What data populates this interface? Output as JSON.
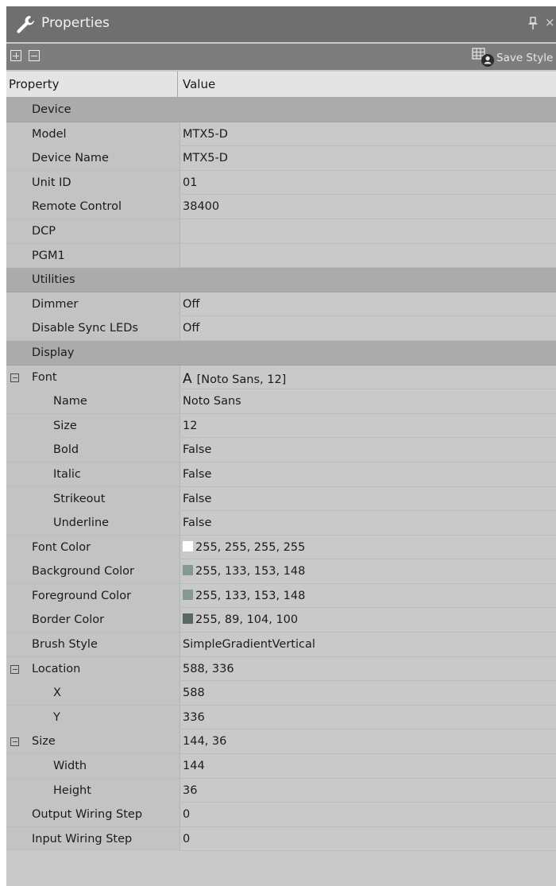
{
  "window": {
    "title": "Properties"
  },
  "toolbar": {
    "save_style_label": "Save Style"
  },
  "columns": {
    "property": "Property",
    "value": "Value"
  },
  "rows": [
    {
      "type": "category",
      "name": "Device"
    },
    {
      "name": "Model",
      "value": "MTX5-D",
      "level": 1
    },
    {
      "name": "Device Name",
      "value": "MTX5-D",
      "level": 1
    },
    {
      "name": "Unit ID",
      "value": "01",
      "level": 1
    },
    {
      "name": "Remote Control",
      "value": "38400",
      "level": 1
    },
    {
      "name": "DCP",
      "value": "",
      "level": 1
    },
    {
      "name": "PGM1",
      "value": "",
      "level": 1
    },
    {
      "type": "category",
      "name": "Utilities"
    },
    {
      "name": "Dimmer",
      "value": "Off",
      "level": 1
    },
    {
      "name": "Disable Sync LEDs",
      "value": "Off",
      "level": 1
    },
    {
      "type": "category",
      "name": "Display"
    },
    {
      "name": "Font",
      "value": "[Noto Sans, 12]",
      "prefix": "A",
      "level": 1,
      "expander": true
    },
    {
      "name": "Name",
      "value": "Noto Sans",
      "level": 2
    },
    {
      "name": "Size",
      "value": "12",
      "level": 2
    },
    {
      "name": "Bold",
      "value": "False",
      "level": 2
    },
    {
      "name": "Italic",
      "value": "False",
      "level": 2
    },
    {
      "name": "Strikeout",
      "value": "False",
      "level": 2
    },
    {
      "name": "Underline",
      "value": "False",
      "level": 2
    },
    {
      "name": "Font Color",
      "value": "255, 255, 255, 255",
      "swatch": "#ffffff",
      "level": 1
    },
    {
      "name": "Background Color",
      "value": "255, 133, 153, 148",
      "swatch": "#859994",
      "level": 1
    },
    {
      "name": "Foreground Color",
      "value": "255, 133, 153, 148",
      "swatch": "#859994",
      "level": 1
    },
    {
      "name": "Border Color",
      "value": "255, 89, 104, 100",
      "swatch": "#596864",
      "level": 1
    },
    {
      "name": "Brush Style",
      "value": "SimpleGradientVertical",
      "level": 1
    },
    {
      "name": "Location",
      "value": "588, 336",
      "level": 1,
      "expander": true
    },
    {
      "name": "X",
      "value": "588",
      "level": 2
    },
    {
      "name": "Y",
      "value": "336",
      "level": 2
    },
    {
      "name": "Size",
      "value": "144, 36",
      "level": 1,
      "expander": true
    },
    {
      "name": "Width",
      "value": "144",
      "level": 2
    },
    {
      "name": "Height",
      "value": "36",
      "level": 2
    },
    {
      "name": "Output Wiring Step",
      "value": "0",
      "level": 1
    },
    {
      "name": "Input Wiring Step",
      "value": "0",
      "level": 1
    }
  ]
}
